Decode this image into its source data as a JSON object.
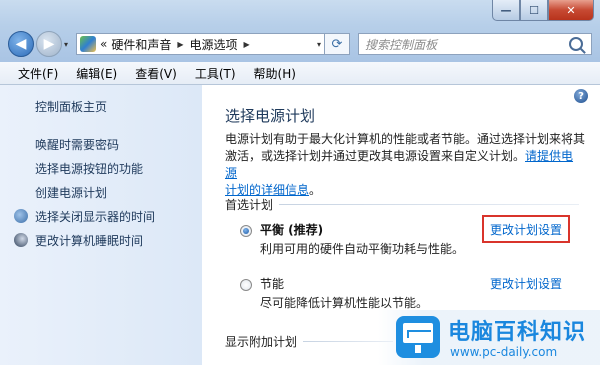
{
  "window": {
    "minimize_glyph": "—",
    "maximize_glyph": "☐",
    "close_glyph": "✕"
  },
  "address": {
    "chevron": "«",
    "segments": [
      "硬件和声音",
      "电源选项"
    ],
    "separator": "▶",
    "dropdown": "▾"
  },
  "nav": {
    "back_glyph": "◀",
    "forward_glyph": "▶",
    "history_glyph": "▾",
    "refresh_glyph": "⟳"
  },
  "search": {
    "placeholder": "搜索控制面板"
  },
  "menu": [
    "文件(F)",
    "编辑(E)",
    "查看(V)",
    "工具(T)",
    "帮助(H)"
  ],
  "sidebar": {
    "home": "控制面板主页",
    "links": [
      "唤醒时需要密码",
      "选择电源按钮的功能",
      "创建电源计划",
      "选择关闭显示器的时间",
      "更改计算机睡眠时间"
    ]
  },
  "main": {
    "help_glyph": "?",
    "title": "选择电源计划",
    "desc_line1": "电源计划有助于最大化计算机的性能或者节能。通过选择计划来将其",
    "desc_line2_pre": "激活，或选择计划并通过更改其电源设置来自定义计划。",
    "desc_link_a": "请提供电源",
    "desc_link_b": "计划的详细信息",
    "desc_end": "。",
    "preferred_label": "首选计划",
    "plans": [
      {
        "name": "平衡 (推荐)",
        "desc": "利用可用的硬件自动平衡功耗与性能。",
        "link": "更改计划设置",
        "selected": true
      },
      {
        "name": "节能",
        "desc": "尽可能降低计算机性能以节能。",
        "link": "更改计划设置",
        "selected": false
      }
    ],
    "additional_label": "显示附加计划"
  },
  "watermark": {
    "title": "电脑百科知识",
    "url": "www.pc-daily.com"
  },
  "colors": {
    "link": "#0066cc",
    "highlight": "#d9342b",
    "watermark": "#1a87de"
  }
}
